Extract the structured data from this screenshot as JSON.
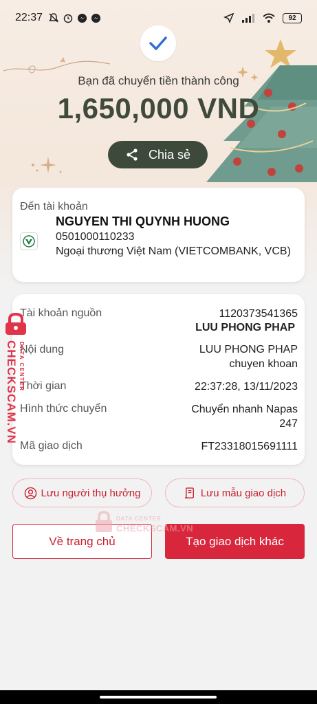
{
  "status_bar": {
    "time": "22:37",
    "battery": "92"
  },
  "header": {
    "success_message": "Bạn đã chuyển tiền thành công",
    "amount": "1,650,000 VND",
    "share_label": "Chia sẻ"
  },
  "destination": {
    "label": "Đến tài khoản",
    "name": "NGUYEN THI QUYNH HUONG",
    "account_number": "0501000110233",
    "bank": "Ngoại thương Việt Nam (VIETCOMBANK, VCB)"
  },
  "details": {
    "source_label": "Tài khoản nguồn",
    "source_account": "1120373541365",
    "source_name": "LUU PHONG PHAP",
    "content_label": "Nội dung",
    "content_line1": "LUU PHONG PHAP",
    "content_line2": "chuyen khoan",
    "time_label": "Thời gian",
    "time_value": "22:37:28, 13/11/2023",
    "method_label": "Hình thức chuyển",
    "method_line1": "Chuyển nhanh Napas",
    "method_line2": "247",
    "txn_label": "Mã giao dịch",
    "txn_value": "FT23318015691111"
  },
  "actions": {
    "save_beneficiary": "Lưu người thụ hưởng",
    "save_template": "Lưu mẫu giao dịch",
    "home": "Về trang chủ",
    "new_transaction": "Tạo giao dịch khác"
  },
  "watermark": {
    "brand": "CHECKSCAM.VN",
    "subtitle": "DATA CENTER",
    "center_small": "DATA CENTER",
    "center_brand": "CHECKSCAM.VN"
  },
  "colors": {
    "accent_red": "#d8263c",
    "dark_green": "#3d4a3b",
    "check_blue": "#2f6fd3"
  }
}
